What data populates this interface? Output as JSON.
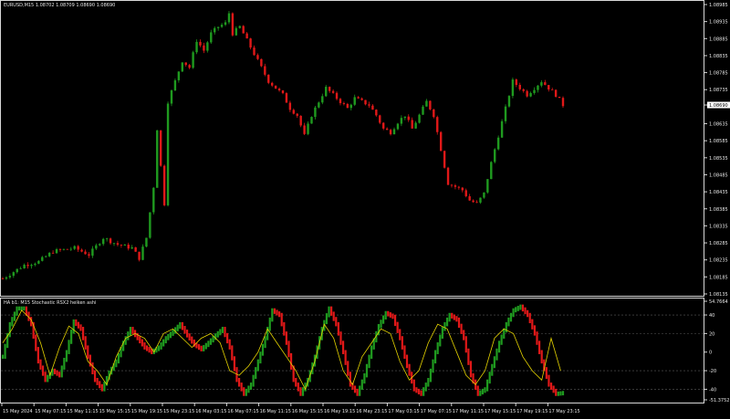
{
  "window": {
    "title": "EURUSD,M15  1.08702 1.08709 1.08690 1.08690",
    "indicator_title": "HA b1: M15 Stochastic RSX2 heiken ashi"
  },
  "colors": {
    "background": "#000000",
    "bull": "#1f9a1f",
    "bear": "#e01818",
    "signal": "#e6d400",
    "text": "#e6e6e6",
    "grid": "#5a5a5a",
    "price_tag_bg": "#ffffff",
    "price_tag_text": "#000000"
  },
  "chart_data": [
    {
      "type": "candlestick",
      "title": "EURUSD,M15  1.08702 1.08709 1.08690 1.08690",
      "symbol": "EURUSD",
      "timeframe": "M15",
      "ohlc_current": {
        "open": 1.08702,
        "high": 1.08709,
        "low": 1.0869,
        "close": 1.0869
      },
      "current_price_label": "1.08690",
      "ylim": [
        1.08135,
        1.08985
      ],
      "y_ticks": [
        "1.08985",
        "1.08935",
        "1.08885",
        "1.08835",
        "1.08785",
        "1.08735",
        "1.08690",
        "1.08635",
        "1.08585",
        "1.08535",
        "1.08485",
        "1.08435",
        "1.08385",
        "1.08335",
        "1.08285",
        "1.08235",
        "1.08185",
        "1.08135"
      ],
      "close_path": [
        [
          0,
          1.0818
        ],
        [
          6,
          1.0822
        ],
        [
          10,
          1.0823
        ],
        [
          14,
          1.0826
        ],
        [
          20,
          1.0827
        ],
        [
          24,
          1.0825
        ],
        [
          28,
          1.083
        ],
        [
          32,
          1.0828
        ],
        [
          36,
          1.0827
        ],
        [
          38,
          1.0824
        ],
        [
          40,
          1.083
        ],
        [
          42,
          1.0845
        ],
        [
          43,
          1.0862
        ],
        [
          45,
          1.084
        ],
        [
          46,
          1.087
        ],
        [
          48,
          1.0876
        ],
        [
          50,
          1.0882
        ],
        [
          52,
          1.088
        ],
        [
          54,
          1.0888
        ],
        [
          56,
          1.0885
        ],
        [
          58,
          1.089
        ],
        [
          60,
          1.0892
        ],
        [
          62,
          1.0893
        ],
        [
          63,
          1.0896
        ],
        [
          64,
          1.089
        ],
        [
          66,
          1.0892
        ],
        [
          68,
          1.0888
        ],
        [
          70,
          1.0884
        ],
        [
          72,
          1.088
        ],
        [
          74,
          1.0876
        ],
        [
          76,
          1.0874
        ],
        [
          78,
          1.0872
        ],
        [
          80,
          1.0868
        ],
        [
          82,
          1.0866
        ],
        [
          84,
          1.086
        ],
        [
          86,
          1.0866
        ],
        [
          88,
          1.087
        ],
        [
          90,
          1.0874
        ],
        [
          92,
          1.0872
        ],
        [
          94,
          1.087
        ],
        [
          96,
          1.0868
        ],
        [
          98,
          1.0871
        ],
        [
          100,
          1.087
        ],
        [
          102,
          1.0869
        ],
        [
          104,
          1.0866
        ],
        [
          106,
          1.0862
        ],
        [
          108,
          1.0861
        ],
        [
          110,
          1.0864
        ],
        [
          112,
          1.0866
        ],
        [
          114,
          1.0862
        ],
        [
          116,
          1.0866
        ],
        [
          118,
          1.087
        ],
        [
          120,
          1.0866
        ],
        [
          122,
          1.0856
        ],
        [
          124,
          1.0846
        ],
        [
          126,
          1.0845
        ],
        [
          128,
          1.0844
        ],
        [
          130,
          1.0841
        ],
        [
          132,
          1.084
        ],
        [
          134,
          1.0843
        ],
        [
          136,
          1.0852
        ],
        [
          138,
          1.086
        ],
        [
          140,
          1.0868
        ],
        [
          142,
          1.0876
        ],
        [
          144,
          1.0874
        ],
        [
          146,
          1.0872
        ],
        [
          148,
          1.0874
        ],
        [
          150,
          1.0876
        ],
        [
          152,
          1.0874
        ],
        [
          154,
          1.0872
        ],
        [
          156,
          1.0869
        ]
      ]
    },
    {
      "type": "line",
      "title": "HA b1: M15 Stochastic RSX2 heiken ashi",
      "ylim": [
        -51.3752,
        54.7664
      ],
      "y_ticks": [
        "54.7664",
        "40",
        "20",
        "0",
        "-20",
        "-40",
        "-51.3752"
      ],
      "levels": [
        40,
        20,
        -20,
        -40
      ],
      "series": [
        {
          "role": "oscillator",
          "values": [
            [
              0,
              -5
            ],
            [
              3,
              30
            ],
            [
              6,
              47
            ],
            [
              9,
              47
            ],
            [
              12,
              30
            ],
            [
              15,
              -10
            ],
            [
              18,
              -30
            ],
            [
              21,
              -20
            ],
            [
              24,
              -25
            ],
            [
              27,
              0
            ],
            [
              30,
              33
            ],
            [
              33,
              25
            ],
            [
              36,
              -5
            ],
            [
              39,
              -30
            ],
            [
              42,
              -40
            ],
            [
              45,
              -22
            ],
            [
              48,
              -10
            ],
            [
              51,
              10
            ],
            [
              54,
              25
            ],
            [
              57,
              15
            ],
            [
              60,
              5
            ],
            [
              63,
              0
            ],
            [
              66,
              5
            ],
            [
              69,
              15
            ],
            [
              72,
              22
            ],
            [
              75,
              30
            ],
            [
              78,
              18
            ],
            [
              81,
              8
            ],
            [
              84,
              3
            ],
            [
              87,
              10
            ],
            [
              90,
              18
            ],
            [
              93,
              25
            ],
            [
              96,
              5
            ],
            [
              99,
              -30
            ],
            [
              102,
              -45
            ],
            [
              105,
              -35
            ],
            [
              108,
              -10
            ],
            [
              111,
              15
            ],
            [
              114,
              45
            ],
            [
              117,
              40
            ],
            [
              120,
              10
            ],
            [
              123,
              -30
            ],
            [
              126,
              -45
            ],
            [
              129,
              -30
            ],
            [
              132,
              -5
            ],
            [
              135,
              25
            ],
            [
              138,
              47
            ],
            [
              141,
              30
            ],
            [
              144,
              0
            ],
            [
              147,
              -35
            ],
            [
              150,
              -45
            ],
            [
              153,
              -25
            ],
            [
              156,
              5
            ],
            [
              159,
              28
            ],
            [
              162,
              42
            ],
            [
              165,
              38
            ],
            [
              168,
              15
            ],
            [
              171,
              -15
            ],
            [
              174,
              -40
            ],
            [
              177,
              -45
            ],
            [
              180,
              -30
            ],
            [
              183,
              0
            ],
            [
              186,
              25
            ],
            [
              189,
              40
            ],
            [
              192,
              35
            ],
            [
              195,
              15
            ],
            [
              198,
              -25
            ],
            [
              201,
              -45
            ],
            [
              204,
              -40
            ],
            [
              207,
              -15
            ],
            [
              210,
              10
            ],
            [
              213,
              30
            ],
            [
              216,
              45
            ],
            [
              219,
              49
            ],
            [
              222,
              40
            ],
            [
              225,
              20
            ],
            [
              228,
              -10
            ],
            [
              231,
              -35
            ],
            [
              234,
              -45
            ],
            [
              237,
              -44
            ]
          ]
        },
        {
          "role": "signal",
          "values": [
            [
              0,
              10
            ],
            [
              4,
              25
            ],
            [
              8,
              45
            ],
            [
              12,
              35
            ],
            [
              16,
              10
            ],
            [
              20,
              -25
            ],
            [
              24,
              5
            ],
            [
              28,
              28
            ],
            [
              32,
              20
            ],
            [
              36,
              -10
            ],
            [
              40,
              -20
            ],
            [
              44,
              -35
            ],
            [
              48,
              -5
            ],
            [
              52,
              15
            ],
            [
              56,
              20
            ],
            [
              60,
              15
            ],
            [
              64,
              0
            ],
            [
              68,
              20
            ],
            [
              72,
              25
            ],
            [
              76,
              15
            ],
            [
              80,
              5
            ],
            [
              84,
              15
            ],
            [
              88,
              20
            ],
            [
              92,
              10
            ],
            [
              96,
              -20
            ],
            [
              100,
              -25
            ],
            [
              104,
              -15
            ],
            [
              108,
              0
            ],
            [
              112,
              25
            ],
            [
              116,
              10
            ],
            [
              120,
              -5
            ],
            [
              124,
              -20
            ],
            [
              128,
              -40
            ],
            [
              132,
              -10
            ],
            [
              136,
              30
            ],
            [
              140,
              15
            ],
            [
              144,
              -20
            ],
            [
              148,
              -35
            ],
            [
              152,
              -5
            ],
            [
              156,
              10
            ],
            [
              160,
              25
            ],
            [
              164,
              20
            ],
            [
              168,
              -10
            ],
            [
              172,
              -30
            ],
            [
              176,
              -20
            ],
            [
              180,
              10
            ],
            [
              184,
              30
            ],
            [
              188,
              25
            ],
            [
              192,
              0
            ],
            [
              196,
              -25
            ],
            [
              200,
              -35
            ],
            [
              204,
              -20
            ],
            [
              208,
              15
            ],
            [
              212,
              25
            ],
            [
              216,
              20
            ],
            [
              220,
              -5
            ],
            [
              224,
              -20
            ],
            [
              228,
              -30
            ],
            [
              232,
              15
            ],
            [
              236,
              -20
            ]
          ]
        }
      ]
    }
  ],
  "time_axis": {
    "labels": [
      "15 May 2024",
      "15 May 07:15",
      "15 May 11:15",
      "15 May 15:15",
      "15 May 19:15",
      "15 May 23:15",
      "16 May 03:15",
      "16 May 07:15",
      "16 May 11:15",
      "16 May 15:15",
      "16 May 19:15",
      "16 May 23:15",
      "17 May 03:15",
      "17 May 07:15",
      "17 May 11:15",
      "17 May 15:15",
      "17 May 19:15",
      "17 May 23:15"
    ]
  }
}
